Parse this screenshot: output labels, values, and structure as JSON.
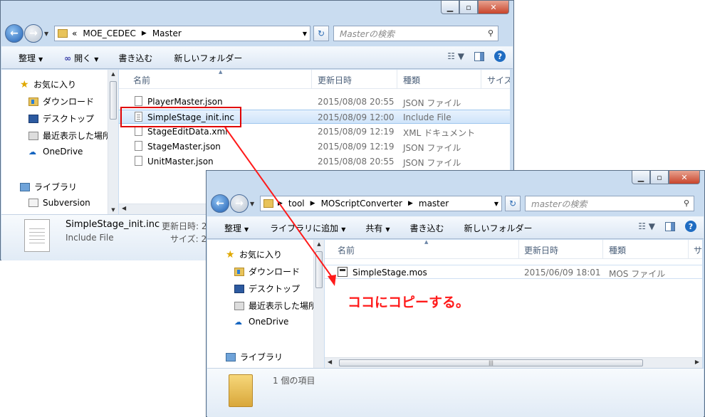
{
  "window1": {
    "address": {
      "chevron": "«",
      "crumbs": [
        "MOE_CEDEC",
        "Master"
      ]
    },
    "search_placeholder": "Masterの検索",
    "toolbar": {
      "organize": "整理",
      "open": "開く",
      "burn": "書き込む",
      "new_folder": "新しいフォルダー"
    },
    "nav": {
      "favorites": "お気に入り",
      "downloads": "ダウンロード",
      "desktop": "デスクトップ",
      "recent": "最近表示した場所",
      "onedrive": "OneDrive",
      "libraries": "ライブラリ",
      "subversion": "Subversion"
    },
    "columns": {
      "name": "名前",
      "date": "更新日時",
      "type": "種類",
      "size": "サイズ"
    },
    "files": [
      {
        "name": "PlayerMaster.json",
        "date": "2015/08/08 20:55",
        "type": "JSON ファイル"
      },
      {
        "name": "SimpleStage_init.inc",
        "date": "2015/08/09 12:00",
        "type": "Include File"
      },
      {
        "name": "StageEditData.xml",
        "date": "2015/08/09 12:19",
        "type": "XML ドキュメント"
      },
      {
        "name": "StageMaster.json",
        "date": "2015/08/09 12:19",
        "type": "JSON ファイル"
      },
      {
        "name": "UnitMaster.json",
        "date": "2015/08/08 20:55",
        "type": "JSON ファイル"
      }
    ],
    "details": {
      "filename": "SimpleStage_init.inc",
      "filetype": "Include File",
      "modified_label": "更新日時: 2",
      "size_label": "サイズ: 2"
    }
  },
  "window2": {
    "address": {
      "crumbs": [
        "tool",
        "MOScriptConverter",
        "master"
      ]
    },
    "search_placeholder": "masterの検索",
    "toolbar": {
      "organize": "整理",
      "add_library": "ライブラリに追加",
      "share": "共有",
      "burn": "書き込む",
      "new_folder": "新しいフォルダー"
    },
    "nav": {
      "favorites": "お気に入り",
      "downloads": "ダウンロード",
      "desktop": "デスクトップ",
      "recent": "最近表示した場所",
      "onedrive": "OneDrive",
      "libraries": "ライブラリ"
    },
    "columns": {
      "name": "名前",
      "date": "更新日時",
      "type": "種類",
      "size": "サ"
    },
    "files": [
      {
        "name": "SimpleStage.mos",
        "date": "2015/06/09 18:01",
        "type": "MOS ファイル"
      }
    ],
    "details": {
      "item_count": "1 個の項目"
    }
  },
  "annotation": {
    "text": "ココにコピーする。",
    "color": "#ff1a1a"
  },
  "colors": {
    "accent": "#e00000",
    "selection": "#cfe4fa",
    "frame": "#c9dcf0"
  }
}
